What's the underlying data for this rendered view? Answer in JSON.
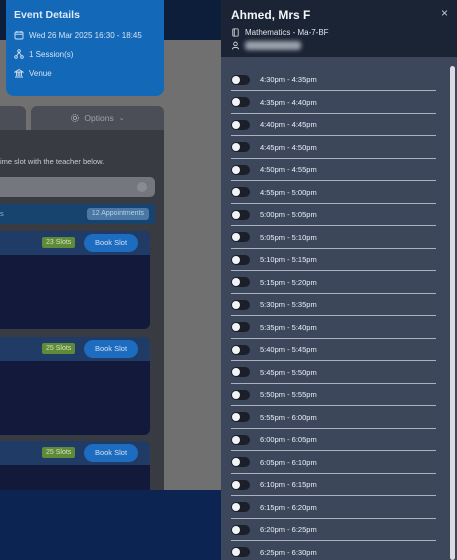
{
  "event": {
    "title": "Event Details",
    "date": "Wed 26 Mar 2025 16:30 - 18:45",
    "sessions": "1 Session(s)",
    "venue": "Venue"
  },
  "options_label": "Options",
  "instructions": "ime slot with the teacher below.",
  "appointments_badge": "12 Appointments",
  "appointments_bar_fragment": "s",
  "slot_cards": [
    {
      "count": "23 Slots",
      "button": "Book Slot"
    },
    {
      "count": "25 Slots",
      "button": "Book Slot"
    },
    {
      "count": "25 Slots",
      "button": "Book Slot"
    }
  ],
  "drawer": {
    "teacher": "Ahmed, Mrs F",
    "close": "×",
    "subject": "Mathematics - Ma-7-BF",
    "slots": [
      "4:30pm - 4:35pm",
      "4:35pm - 4:40pm",
      "4:40pm - 4:45pm",
      "4:45pm - 4:50pm",
      "4:50pm - 4:55pm",
      "4:55pm - 5:00pm",
      "5:00pm - 5:05pm",
      "5:05pm - 5:10pm",
      "5:10pm - 5:15pm",
      "5:15pm - 5:20pm",
      "5:30pm - 5:35pm",
      "5:35pm - 5:40pm",
      "5:40pm - 5:45pm",
      "5:45pm - 5:50pm",
      "5:50pm - 5:55pm",
      "5:55pm - 6:00pm",
      "6:00pm - 6:05pm",
      "6:05pm - 6:10pm",
      "6:10pm - 6:15pm",
      "6:15pm - 6:20pm",
      "6:20pm - 6:25pm",
      "6:25pm - 6:30pm"
    ]
  },
  "colors": {
    "drawer_bg": "#3c475c",
    "drawer_header": "#1b2434",
    "event_card": "#1369b8",
    "book_button": "#1d6cc0",
    "slot_count_badge": "#5f8a3a"
  }
}
